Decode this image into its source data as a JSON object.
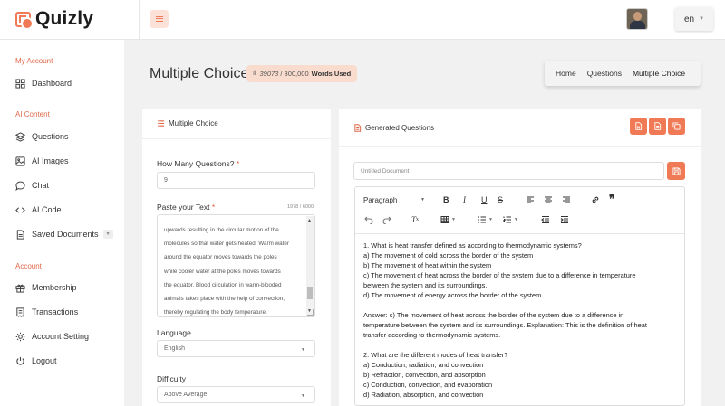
{
  "app": {
    "name": "Quizly",
    "language": "en"
  },
  "sidebar": {
    "sections": [
      {
        "title": "My Account",
        "items": [
          {
            "label": "Dashboard",
            "icon": "grid-icon"
          }
        ]
      },
      {
        "title": "AI Content",
        "items": [
          {
            "label": "Questions",
            "icon": "layers-icon"
          },
          {
            "label": "AI Images",
            "icon": "image-icon"
          },
          {
            "label": "Chat",
            "icon": "chat-icon"
          },
          {
            "label": "AI Code",
            "icon": "code-icon"
          },
          {
            "label": "Saved Documents",
            "icon": "document-icon"
          }
        ]
      },
      {
        "title": "Account",
        "items": [
          {
            "label": "Membership",
            "icon": "gift-icon"
          },
          {
            "label": "Transactions",
            "icon": "receipt-icon"
          },
          {
            "label": "Account Setting",
            "icon": "gear-icon"
          },
          {
            "label": "Logout",
            "icon": "power-icon"
          }
        ]
      }
    ]
  },
  "page": {
    "title": "Multiple Choice",
    "words_used": "39073",
    "words_limit": "/ 300,000",
    "words_label": "Words Used",
    "breadcrumb": [
      "Home",
      "Questions",
      "Multiple Choice"
    ]
  },
  "form": {
    "card_title": "Multiple Choice",
    "questions_label": "How Many Questions?",
    "questions_value": "9",
    "text_label": "Paste your Text",
    "char_count": "1978 / 6000",
    "text_lines": [
      "upwards resulting in the circular motion of the",
      "molecules so that water gets heated. Warm water",
      "around the equator moves towards the poles",
      "while cooler water at the poles moves towards",
      "the equator. Blood circulation in warm-blooded",
      "animals takes place with the help of convection,",
      "thereby regulating the body temperature."
    ],
    "language_label": "Language",
    "language_value": "English",
    "difficulty_label": "Difficulty",
    "difficulty_value": "Above Average"
  },
  "generated": {
    "card_title": "Generated Questions",
    "document_placeholder": "Untitled Document",
    "paragraph_style": "Paragraph",
    "content": [
      "1. What is heat transfer defined as according to thermodynamic systems?",
      "a) The movement of cold across the border of the system",
      "b) The movement of heat within the system",
      "c) The movement of heat across the border of the system due to a difference in temperature",
      "between the system and its surroundings.",
      "d) The movement of energy across the border of the system",
      "",
      "Answer: c) The movement of heat across the border of the system due to a difference in",
      "temperature between the system and its surroundings. Explanation: This is the definition of heat",
      "transfer according to thermodynamic systems.",
      "",
      "2. What are the different modes of heat transfer?",
      "a) Conduction, radiation, and convection",
      "b) Refraction, convection, and absorption",
      "c) Conduction, convection, and evaporation",
      "d) Radiation, absorption, and convection"
    ]
  },
  "colors": {
    "accent": "#f07a55",
    "accent_light": "#fadccf",
    "section": "#e0684a"
  }
}
